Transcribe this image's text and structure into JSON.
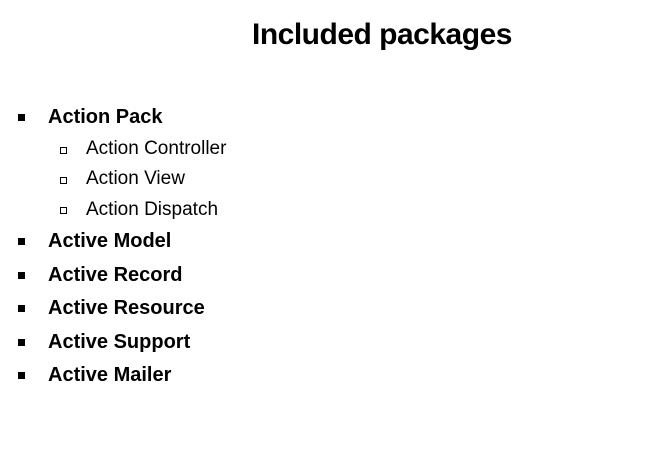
{
  "slide": {
    "title": "Included packages",
    "items": [
      {
        "label": "Action Pack",
        "children": [
          {
            "label": "Action Controller"
          },
          {
            "label": "Action View"
          },
          {
            "label": "Action Dispatch"
          }
        ]
      },
      {
        "label": "Active Model"
      },
      {
        "label": "Active Record"
      },
      {
        "label": "Active Resource"
      },
      {
        "label": "Active Support"
      },
      {
        "label": "Active Mailer"
      }
    ]
  }
}
